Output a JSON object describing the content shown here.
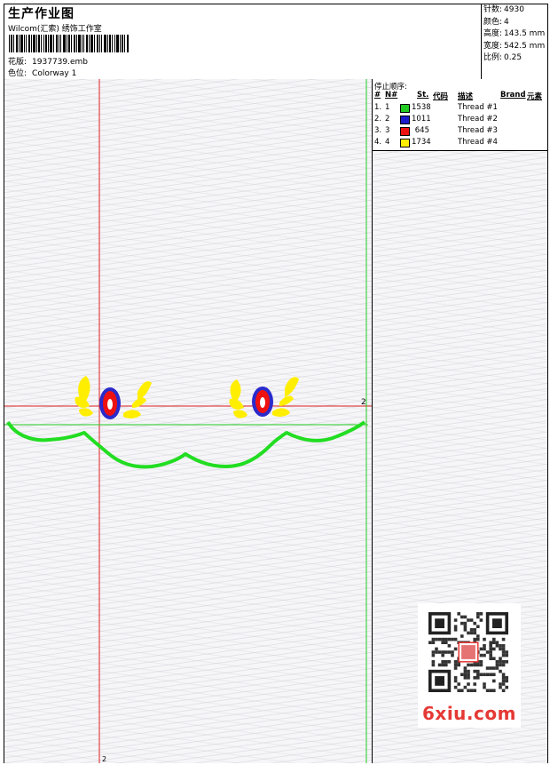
{
  "header": {
    "title": "生产作业图",
    "subtitle": "Wilcom(汇索) 绣饰工作室",
    "design_label": "花版:",
    "design_value": "1937739.emb",
    "colorway_label": "色位:",
    "colorway_value": "Colorway 1"
  },
  "stats": {
    "stitches_label": "针数:",
    "stitches_value": "4930",
    "colors_label": "颜色:",
    "colors_value": "4",
    "height_label": "高度:",
    "height_value": "143.5 mm",
    "width_label": "宽度:",
    "width_value": "542.5 mm",
    "scale_label": "比例:",
    "scale_value": "0.25"
  },
  "stop_sequence": {
    "title": "停止顺序:",
    "headers": {
      "hash": "#",
      "n": "N#",
      "st": "St.",
      "code": "代码",
      "desc": "描述",
      "brand": "Brand",
      "element": "元素"
    },
    "rows": [
      {
        "index": "1.",
        "n": "1",
        "stitches": "1538",
        "color": "#22cc22",
        "desc": "Thread #1"
      },
      {
        "index": "2.",
        "n": "2",
        "stitches": "1011",
        "color": "#1a1acc",
        "desc": "Thread #2"
      },
      {
        "index": "3.",
        "n": "3",
        "stitches": "645",
        "color": "#ee1111",
        "desc": "Thread #3"
      },
      {
        "index": "4.",
        "n": "4",
        "stitches": "1734",
        "color": "#ffee00",
        "desc": "Thread #4"
      }
    ]
  },
  "canvas": {
    "marker_right": "2",
    "marker_bottom": "2",
    "guide_red": "#e02020",
    "guide_green": "#22cc22"
  },
  "watermark": {
    "logo": "6xiu.com",
    "seal": "印图图印"
  }
}
